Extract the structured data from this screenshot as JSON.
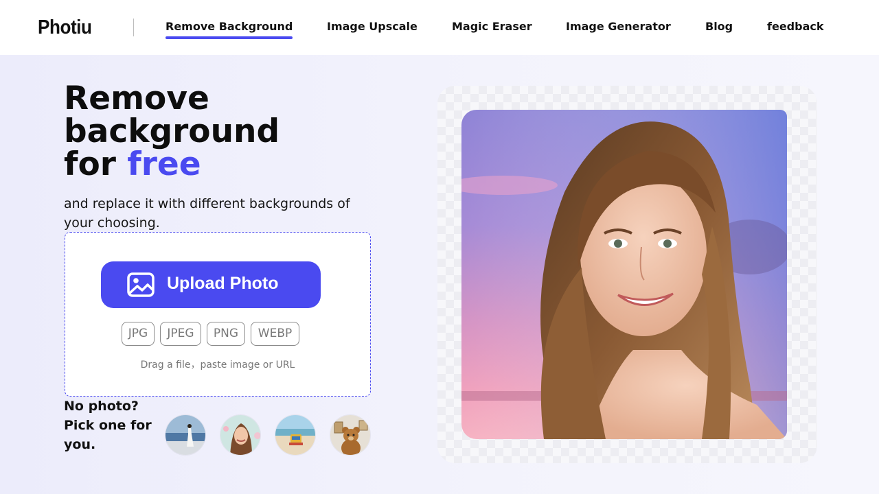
{
  "header": {
    "logo": "Photiu",
    "nav": [
      {
        "label": "Remove Background",
        "active": true
      },
      {
        "label": "Image Upscale"
      },
      {
        "label": "Magic Eraser"
      },
      {
        "label": "Image Generator"
      },
      {
        "label": "Blog"
      },
      {
        "label": "feedback"
      }
    ]
  },
  "hero": {
    "title_line1": "Remove",
    "title_line2": "background",
    "title_line3_prefix": "for ",
    "title_line3_accent": "free",
    "subtitle": "and replace it with different backgrounds of your choosing."
  },
  "upload": {
    "button_label": "Upload Photo",
    "button_icon": "image-icon",
    "formats": [
      "JPG",
      "JPEG",
      "PNG",
      "WEBP"
    ],
    "hint": "Drag a file，paste image or URL"
  },
  "samples": {
    "label": "No photo? Pick one for you."
  },
  "colors": {
    "accent": "#4a4af0",
    "header_bg": "#ffffff",
    "page_bg": "#ececfb"
  }
}
